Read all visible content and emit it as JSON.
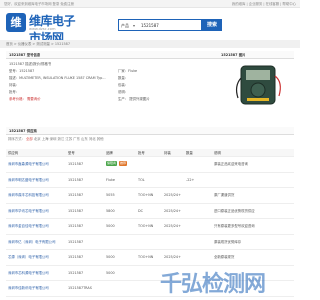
{
  "topbar": {
    "left": "您好，欢迎来到维库电子市场网  登录  免费注册",
    "right": "我的维库 | 企业服务 | 在线客服 | 帮助中心"
  },
  "logo": {
    "mark": "维",
    "name": "维库电子市场网",
    "url": "www.dzsc.com"
  },
  "search": {
    "category": "产品",
    "value": "1521587",
    "button": "搜索"
  },
  "breadcrumb": "首页 > 仪器仪表 > 测试测量 > 1521587",
  "info": {
    "section_title": "1521587 型号信息",
    "image_title": "1521587 图片",
    "rows": [
      "1521587 描述/报价/规格书",
      "型号：1521587",
      "描述：MULTIMETER, INSULATION FLUKE 1587 CRAM Typ...",
      "封装：",
      "批号：",
      "参考价格：  需要询价"
    ],
    "right_rows": [
      "厂家：Fluke",
      "数量：",
      "",
      "包装：",
      "说明：",
      "生产：  提供外观图片"
    ]
  },
  "list": {
    "section_title": "1521587 供应商",
    "filter_label": "排序方式：",
    "filter_active": "全部",
    "filter_rest": "北京 上海 深圳 浙江 江苏 广东 山东 河北 其他"
  },
  "table": {
    "headers": [
      "供应商",
      "型号",
      "品牌",
      "批号",
      "封装",
      "数量",
      "说明"
    ],
    "rows": [
      {
        "supplier": "深圳市鑫森源电子有限公司",
        "model": "1521587",
        "brand": "",
        "lot": "",
        "pkg": "",
        "qty": "",
        "note": "原装正品欢迎来电咨询",
        "badges": [
          "保障商",
          "推荐"
        ]
      },
      {
        "supplier": "深圳市明达盛电子有限公司",
        "model": "1521587",
        "brand": "Fluke",
        "lot": "TOL",
        "pkg": "",
        "qty": "-22+",
        "note": ""
      },
      {
        "supplier": "深圳市鼎丰芯科技有限公司",
        "model": "1521587",
        "brand": "5055",
        "lot": "TOO+NN",
        "pkg": "2025/24+",
        "qty": "",
        "note": "原厂渠道供货"
      },
      {
        "supplier": "深圳市华讯芯电子有限公司",
        "model": "1521587",
        "brand": "5800",
        "lot": "DC",
        "pkg": "2025/24+",
        "qty": "",
        "note": "进口原装正品优势现货供应"
      },
      {
        "supplier": "深圳市金百佳电子有限公司",
        "model": "1521587",
        "brand": "5000",
        "lot": "TOO+NN",
        "pkg": "2025/24+",
        "qty": "",
        "note": "只有原装更多型号欢迎咨询"
      },
      {
        "supplier": "深圳市亿（深圳）电子有限公司",
        "model": "1521587",
        "brand": "",
        "lot": "",
        "pkg": "",
        "qty": "",
        "note": "原装现货优势库存"
      },
      {
        "supplier": "芯源（深圳）电子有限公司",
        "model": "1521587",
        "brand": "5000",
        "lot": "TOO+NN",
        "pkg": "2025/24+",
        "qty": "",
        "note": "全新原装现货"
      },
      {
        "supplier": "深圳市芯科源电子有限公司",
        "model": "1521587",
        "brand": "5000",
        "lot": "",
        "pkg": "",
        "qty": "",
        "note": ""
      },
      {
        "supplier": "深圳市佳新讯电子有限公司",
        "model": "1521587TRAS",
        "brand": "",
        "lot": "",
        "pkg": "",
        "qty": "",
        "note": ""
      }
    ]
  },
  "watermark": "千弘检测网"
}
